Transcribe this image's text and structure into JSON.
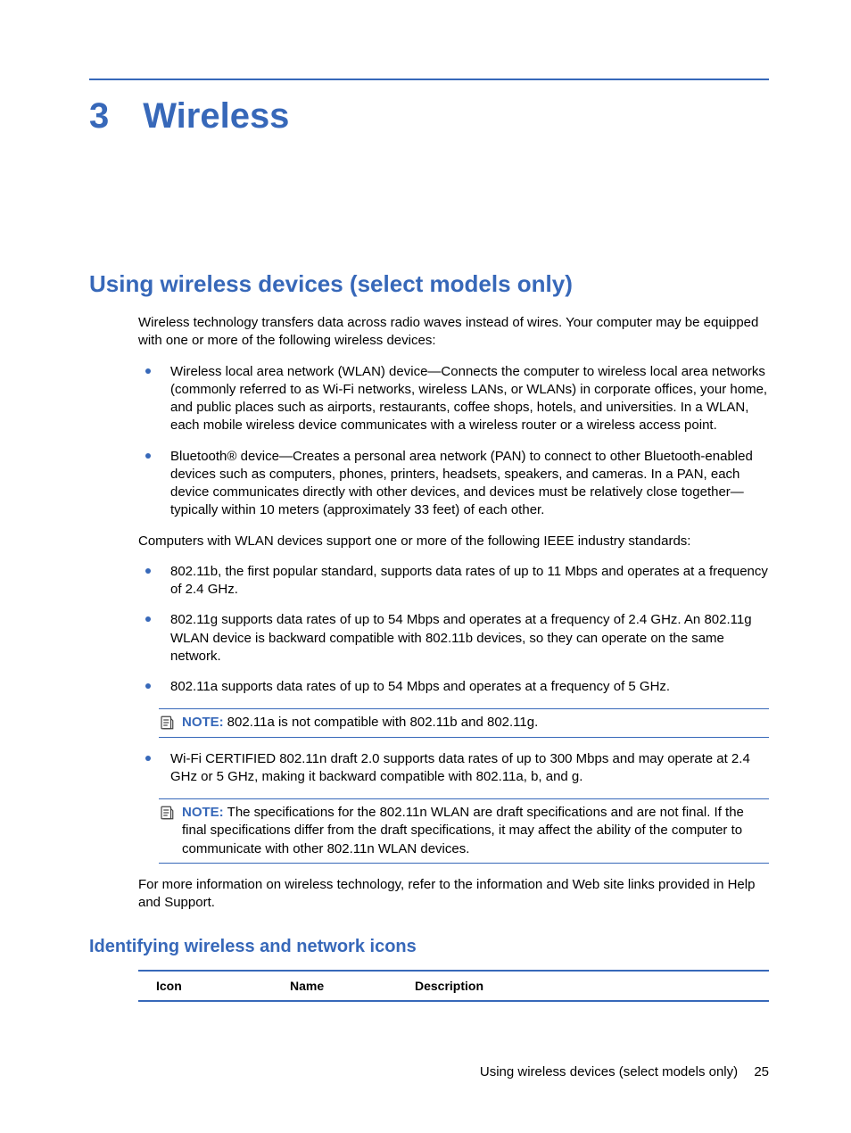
{
  "chapter": {
    "number": "3",
    "title": "Wireless"
  },
  "section": {
    "title": "Using wireless devices (select models only)"
  },
  "intro": "Wireless technology transfers data across radio waves instead of wires. Your computer may be equipped with one or more of the following wireless devices:",
  "devices": [
    "Wireless local area network (WLAN) device—Connects the computer to wireless local area networks (commonly referred to as Wi-Fi networks, wireless LANs, or WLANs) in corporate offices, your home, and public places such as airports, restaurants, coffee shops, hotels, and universities. In a WLAN, each mobile wireless device communicates with a wireless router or a wireless access point.",
    "Bluetooth® device—Creates a personal area network (PAN) to connect to other Bluetooth-enabled devices such as computers, phones, printers, headsets, speakers, and cameras. In a PAN, each device communicates directly with other devices, and devices must be relatively close together—typically within 10 meters (approximately 33 feet) of each other."
  ],
  "standards_intro": "Computers with WLAN devices support one or more of the following IEEE industry standards:",
  "standards": [
    "802.11b, the first popular standard, supports data rates of up to 11 Mbps and operates at a frequency of 2.4 GHz.",
    "802.11g supports data rates of up to 54 Mbps and operates at a frequency of 2.4 GHz. An 802.11g WLAN device is backward compatible with 802.11b devices, so they can operate on the same network.",
    "802.11a supports data rates of up to 54 Mbps and operates at a frequency of 5 GHz."
  ],
  "note1": {
    "label": "NOTE:",
    "text": "802.11a is not compatible with 802.11b and 802.11g."
  },
  "standards2": [
    "Wi-Fi CERTIFIED 802.11n draft 2.0 supports data rates of up to 300 Mbps and may operate at 2.4 GHz or 5 GHz, making it backward compatible with 802.11a, b, and g."
  ],
  "note2": {
    "label": "NOTE:",
    "text": "The specifications for the 802.11n WLAN are draft specifications and are not final. If the final specifications differ from the draft specifications, it may affect the ability of the computer to communicate with other 802.11n WLAN devices."
  },
  "more_info": "For more information on wireless technology, refer to the information and Web site links provided in Help and Support.",
  "subsection": {
    "title": "Identifying wireless and network icons"
  },
  "table": {
    "headers": {
      "icon": "Icon",
      "name": "Name",
      "desc": "Description"
    }
  },
  "footer": {
    "text": "Using wireless devices (select models only)",
    "page": "25"
  }
}
